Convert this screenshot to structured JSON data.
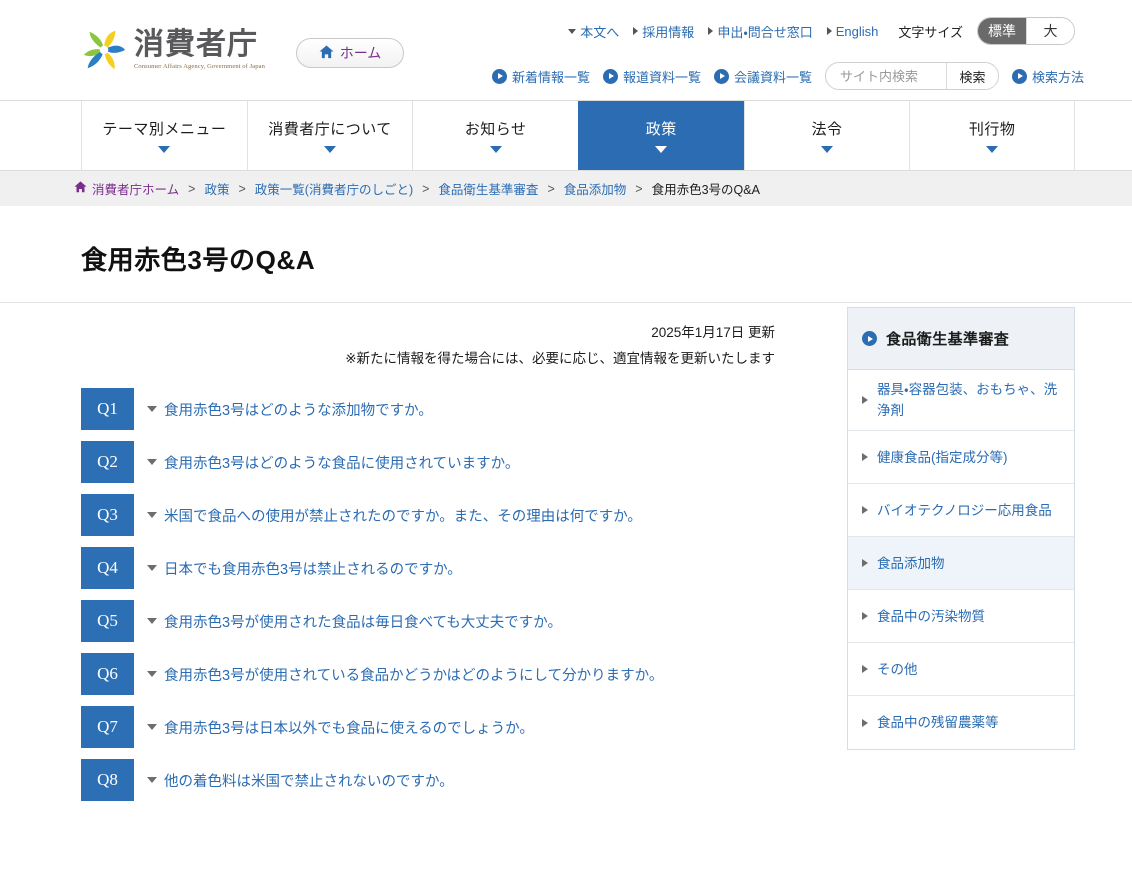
{
  "header": {
    "logo": {
      "ja": "消費者庁",
      "en": "Consumer Affairs Agency, Government of Japan"
    },
    "home_button": "ホーム",
    "top_links": [
      {
        "label": "本文へ",
        "marker": "down"
      },
      {
        "label": "採用情報",
        "marker": "right"
      },
      {
        "label": "申出・問合せ窓口",
        "marker": "right"
      },
      {
        "label": "English",
        "marker": "right"
      }
    ],
    "fontsize": {
      "label": "文字サイズ",
      "normal": "標準",
      "large": "大"
    },
    "second_links": [
      "新着情報一覧",
      "報道資料一覧",
      "会議資料一覧"
    ],
    "search": {
      "placeholder": "サイト内検索",
      "value": "",
      "button": "検索",
      "help_link": "検索方法"
    }
  },
  "gnav": [
    {
      "label": "テーマ別メニュー",
      "active": false
    },
    {
      "label": "消費者庁について",
      "active": false
    },
    {
      "label": "お知らせ",
      "active": false
    },
    {
      "label": "政策",
      "active": true
    },
    {
      "label": "法令",
      "active": false
    },
    {
      "label": "刊行物",
      "active": false
    }
  ],
  "breadcrumb": [
    {
      "label": "消費者庁ホーム",
      "state": "visited"
    },
    {
      "label": "政策",
      "state": "link"
    },
    {
      "label": "政策一覧(消費者庁のしごと)",
      "state": "link"
    },
    {
      "label": "食品衛生基準審査",
      "state": "link"
    },
    {
      "label": "食品添加物",
      "state": "link"
    },
    {
      "label": "食用赤色3号のQ&A",
      "state": "current"
    }
  ],
  "breadcrumb_separator": ">",
  "page": {
    "title": "食用赤色3号のQ&A",
    "updated": "2025年1月17日 更新",
    "note": "※新たに情報を得た場合には、必要に応じ、適宜情報を更新いたします"
  },
  "faq": [
    {
      "id": "Q1",
      "question": "食用赤色3号はどのような添加物ですか。"
    },
    {
      "id": "Q2",
      "question": "食用赤色3号はどのような食品に使用されていますか。"
    },
    {
      "id": "Q3",
      "question": "米国で食品への使用が禁止されたのですか。また、その理由は何ですか。"
    },
    {
      "id": "Q4",
      "question": "日本でも食用赤色3号は禁止されるのですか。"
    },
    {
      "id": "Q5",
      "question": "食用赤色3号が使用された食品は毎日食べても大丈夫ですか。"
    },
    {
      "id": "Q6",
      "question": "食用赤色3号が使用されている食品かどうかはどのようにして分かりますか。"
    },
    {
      "id": "Q7",
      "question": "食用赤色3号は日本以外でも食品に使えるのでしょうか。"
    },
    {
      "id": "Q8",
      "question": "他の着色料は米国で禁止されないのですか。"
    }
  ],
  "sidebar": {
    "heading": "食品衛生基準審査",
    "items": [
      {
        "label": "器具・容器包装、おもちゃ、洗浄剤",
        "active": false
      },
      {
        "label": "健康食品(指定成分等)",
        "active": false
      },
      {
        "label": "バイオテクノロジー応用食品",
        "active": false
      },
      {
        "label": "食品添加物",
        "active": true
      },
      {
        "label": "食品中の汚染物質",
        "active": false
      },
      {
        "label": "その他",
        "active": false
      },
      {
        "label": "食品中の残留農薬等",
        "active": false
      }
    ]
  },
  "colors": {
    "accent_blue": "#2b6cb3",
    "badge_blue": "#2c6fb5",
    "visited_purple": "#7b2d8e",
    "breadcrumb_bg": "#f0f0f0",
    "sidebar_head_bg": "#eef2f7",
    "sidebar_active_bg": "#eef4f9"
  }
}
